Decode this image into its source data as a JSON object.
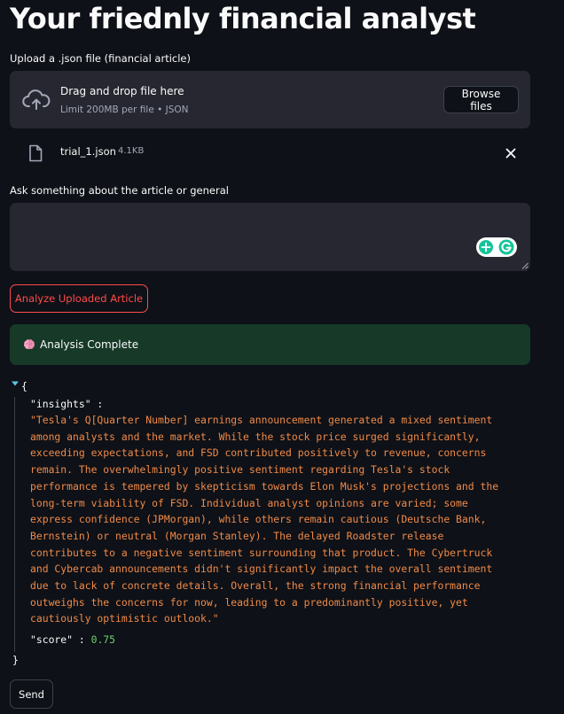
{
  "header": {
    "title": "Your friednly financial analyst"
  },
  "uploader": {
    "label": "Upload a .json file (financial article)",
    "drop_text": "Drag and drop file here",
    "limit_text": "Limit 200MB per file • JSON",
    "browse_label": "Browse files",
    "file": {
      "name": "trial_1.json",
      "size": "4.1KB"
    }
  },
  "question": {
    "label": "Ask something about the article or general",
    "value": "",
    "placeholder": ""
  },
  "analyze_button": {
    "label": "Analyze Uploaded Article"
  },
  "status": {
    "text": "Analysis Complete",
    "icon": "brain-icon"
  },
  "result": {
    "open_brace": "{",
    "close_brace": "}",
    "insights_key": "\"insights\" :",
    "insights_value": "\"Tesla's Q[Quarter Number] earnings announcement generated a mixed sentiment\namong analysts and the market. While the stock price surged significantly,\nexceeding expectations, and FSD contributed positively to revenue, concerns\nremain.  The overwhelmingly positive sentiment regarding Tesla's stock\nperformance is tempered by skepticism towards Elon Musk's projections and the\nlong-term viability of FSD.  Individual analyst opinions are varied; some\nexpress confidence (JPMorgan), while others remain cautious (Deutsche Bank,\nBernstein) or neutral (Morgan Stanley). The delayed Roadster release\ncontributes to a negative sentiment surrounding that product.  The Cybertruck\nand Cybercab announcements didn't significantly impact the overall sentiment\ndue to lack of concrete details.  Overall, the strong financial performance\noutweighs the concerns for now, leading to a predominantly positive, yet\ncautiously optimistic outlook.\"",
    "score_key": "\"score\" :",
    "score_value": "0.75"
  },
  "send_button": {
    "label": "Send"
  },
  "colors": {
    "background": "#0e1117",
    "widget": "#262730",
    "accent": "#ff4b4b",
    "success_bg": "#173928",
    "json_string": "#f08a48",
    "json_number": "#6fd06f"
  }
}
